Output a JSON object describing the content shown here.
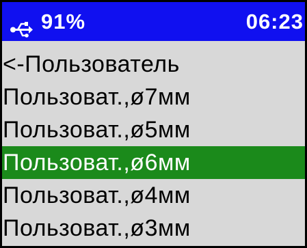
{
  "status_bar": {
    "usb_icon": "usb-icon",
    "battery": "91%",
    "clock": "06:23"
  },
  "menu": {
    "items": [
      {
        "label": "<-Пользователь",
        "selected": false
      },
      {
        "label": "Пользоват.,ø7мм",
        "selected": false
      },
      {
        "label": "Пользоват.,ø5мм",
        "selected": false
      },
      {
        "label": "Пользоват.,ø6мм",
        "selected": true
      },
      {
        "label": "Пользоват.,ø4мм",
        "selected": false
      },
      {
        "label": "Пользоват.,ø3мм",
        "selected": false
      }
    ]
  },
  "colors": {
    "status_bar_bg": "#1010f0",
    "screen_bg": "#d8d8d8",
    "selection_bg": "#1b8a1b",
    "text": "#000000",
    "selected_text": "#ffffff"
  }
}
